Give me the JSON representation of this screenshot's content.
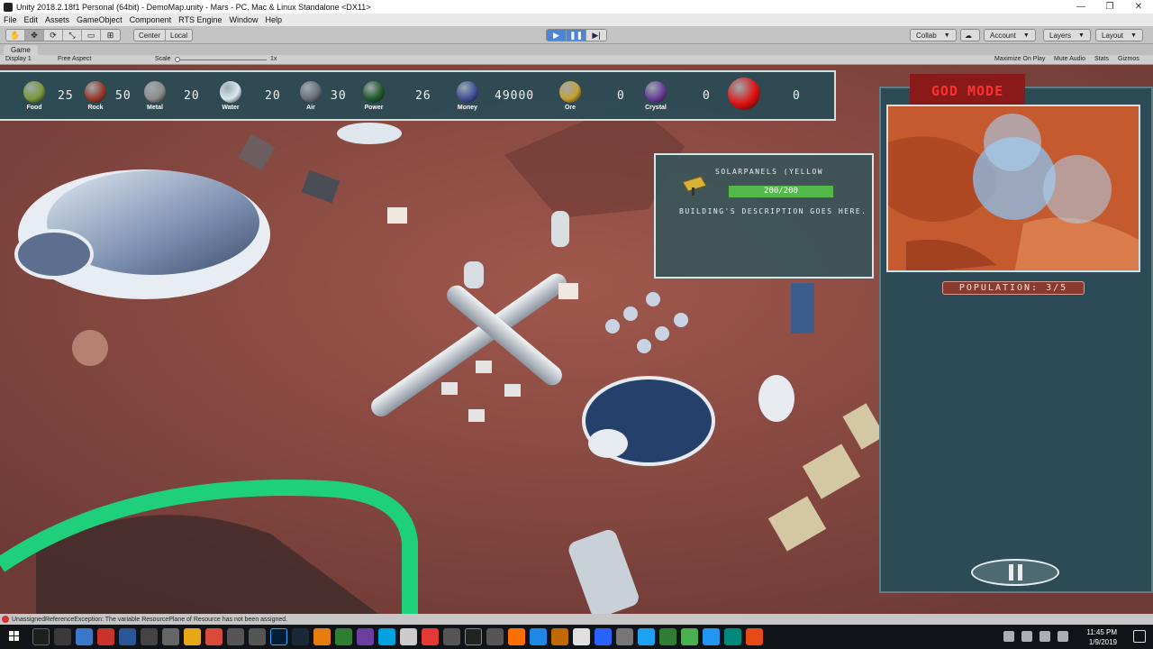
{
  "window": {
    "title": "Unity 2018.2.18f1 Personal (64bit) - DemoMap.unity - Mars - PC, Mac & Linux Standalone <DX11>",
    "minimize": "—",
    "restore": "❐",
    "close": "✕"
  },
  "menu": [
    "File",
    "Edit",
    "Assets",
    "GameObject",
    "Component",
    "RTS Engine",
    "Window",
    "Help"
  ],
  "toolbar": {
    "pivot": "Center",
    "space": "Local",
    "collab": "Collab",
    "account": "Account",
    "layers": "Layers",
    "layout": "Layout"
  },
  "game_tab": {
    "label": "Game",
    "display": "Display 1",
    "aspect": "Free Aspect",
    "scale_label": "Scale",
    "scale_value": "1x",
    "maximize": "Maximize On Play",
    "mute": "Mute Audio",
    "stats": "Stats",
    "gizmos": "Gizmos"
  },
  "resources": [
    {
      "label": "Food",
      "value": "25",
      "color": "#7a9a3a"
    },
    {
      "label": "Rock",
      "value": "50",
      "color": "#9a3a2a"
    },
    {
      "label": "Metal",
      "value": "20",
      "color": "#8c8c8c"
    },
    {
      "label": "Water",
      "value": "20",
      "color": "#d8e8f0"
    },
    {
      "label": "Air",
      "value": "30",
      "color": "#6a6e78"
    },
    {
      "label": "Power",
      "value": "26",
      "color": "#1f5a2a"
    },
    {
      "label": "Money",
      "value": "49000",
      "color": "#3f4f9a"
    },
    {
      "label": "Ore",
      "value": "0",
      "color": "#c8a030"
    },
    {
      "label": "Crystal",
      "value": "0",
      "color": "#6a3a9a"
    },
    {
      "label": "",
      "value": "0",
      "color": "#e01010"
    }
  ],
  "building": {
    "name": "SOLARPANELS (YELLOW",
    "health": "200/200",
    "health_fraction": 1.0,
    "description": "BUILDING'S DESCRIPTION GOES HERE."
  },
  "side": {
    "god_mode": "GOD MODE",
    "population": "POPULATION: 3/5"
  },
  "console": {
    "message": "UnassignedReferenceException: The variable ResourcePlane of Resource has not been assigned."
  },
  "taskbar": {
    "time": "11:45 PM",
    "date": "1/9/2019"
  },
  "colors": {
    "ground": "#8a4a42",
    "panel": "#2c4b56",
    "accent_green": "#55b84a",
    "selection_green": "#1ed07a"
  }
}
